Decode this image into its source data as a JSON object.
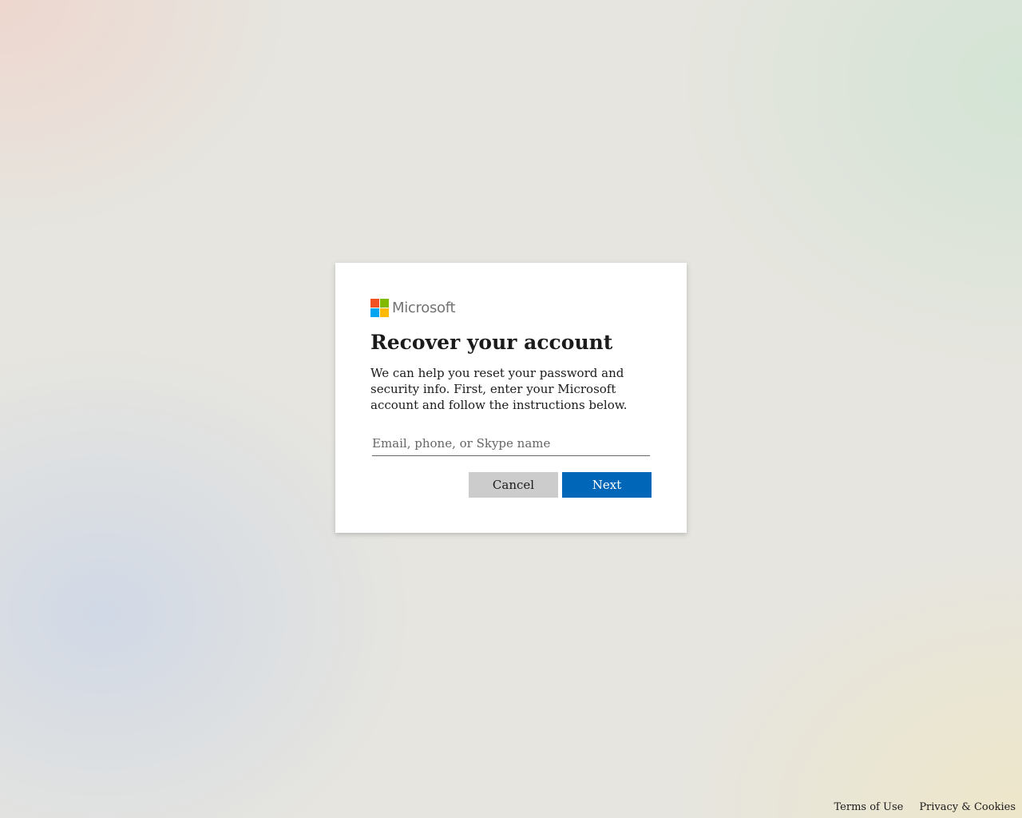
{
  "brand": {
    "name": "Microsoft",
    "logo_colors": [
      "#f25022",
      "#7fba00",
      "#00a4ef",
      "#ffb900"
    ]
  },
  "card": {
    "title": "Recover your account",
    "description": "We can help you reset your password and security info. First, enter your Microsoft account and follow the instructions below.",
    "input": {
      "value": "",
      "placeholder": "Email, phone, or Skype name"
    },
    "cancel_label": "Cancel",
    "next_label": "Next"
  },
  "footer": {
    "terms_label": "Terms of Use",
    "privacy_label": "Privacy & Cookies"
  },
  "colors": {
    "accent": "#0067b8",
    "secondary_button": "#cccccc"
  }
}
